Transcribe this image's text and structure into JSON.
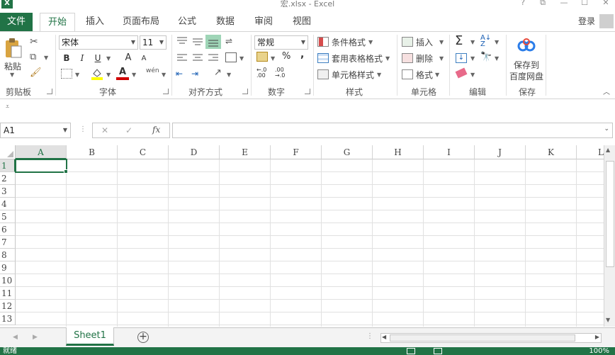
{
  "window": {
    "title": "宏.xlsx - Excel",
    "app_icon_letter": "X",
    "help_label": "?",
    "restore_label": "⧉",
    "minimize_label": "—",
    "maximize_label": "☐",
    "close_label": "✕"
  },
  "tabs": {
    "file": "文件",
    "items": [
      "开始",
      "插入",
      "页面布局",
      "公式",
      "数据",
      "审阅",
      "视图"
    ],
    "active": "开始",
    "login": "登录"
  },
  "ribbon": {
    "clipboard": {
      "label": "剪贴板",
      "paste_label": "粘贴"
    },
    "font": {
      "label": "字体",
      "font_name": "宋体",
      "font_size": "11",
      "bold": "B",
      "italic": "I",
      "underline": "U",
      "grow": "A",
      "shrink": "A",
      "phonetic": "wén",
      "font_color_letter": "A",
      "fill_color": "#ffff00",
      "font_color": "#d00000"
    },
    "alignment": {
      "label": "对齐方式"
    },
    "number": {
      "label": "数字",
      "format": "常规",
      "percent": "%",
      "comma": ","
    },
    "styles": {
      "label": "样式",
      "conditional": "条件格式",
      "table": "套用表格格式",
      "cell_styles": "单元格样式"
    },
    "cells": {
      "label": "单元格",
      "insert": "插入",
      "delete": "删除",
      "format": "格式"
    },
    "editing": {
      "label": "编辑",
      "sum_symbol": "Σ"
    },
    "save": {
      "label": "保存",
      "button_line1": "保存到",
      "button_line2": "百度网盘"
    }
  },
  "formula_bar": {
    "name_box": "A1",
    "fx_label": "fx",
    "cancel_label": "✕",
    "enter_label": "✓",
    "content": ""
  },
  "grid": {
    "columns": [
      "A",
      "B",
      "C",
      "D",
      "E",
      "F",
      "G",
      "H",
      "I",
      "J",
      "K",
      "L"
    ],
    "rows": [
      "1",
      "2",
      "3",
      "4",
      "5",
      "6",
      "7",
      "8",
      "9",
      "10",
      "11",
      "12",
      "13"
    ],
    "active_cell": "A1"
  },
  "sheets": {
    "tabs": [
      "Sheet1"
    ],
    "active": "Sheet1",
    "add_label": "+"
  },
  "status": {
    "text": "就绪",
    "zoom": "100%"
  },
  "colors": {
    "accent": "#217346"
  }
}
